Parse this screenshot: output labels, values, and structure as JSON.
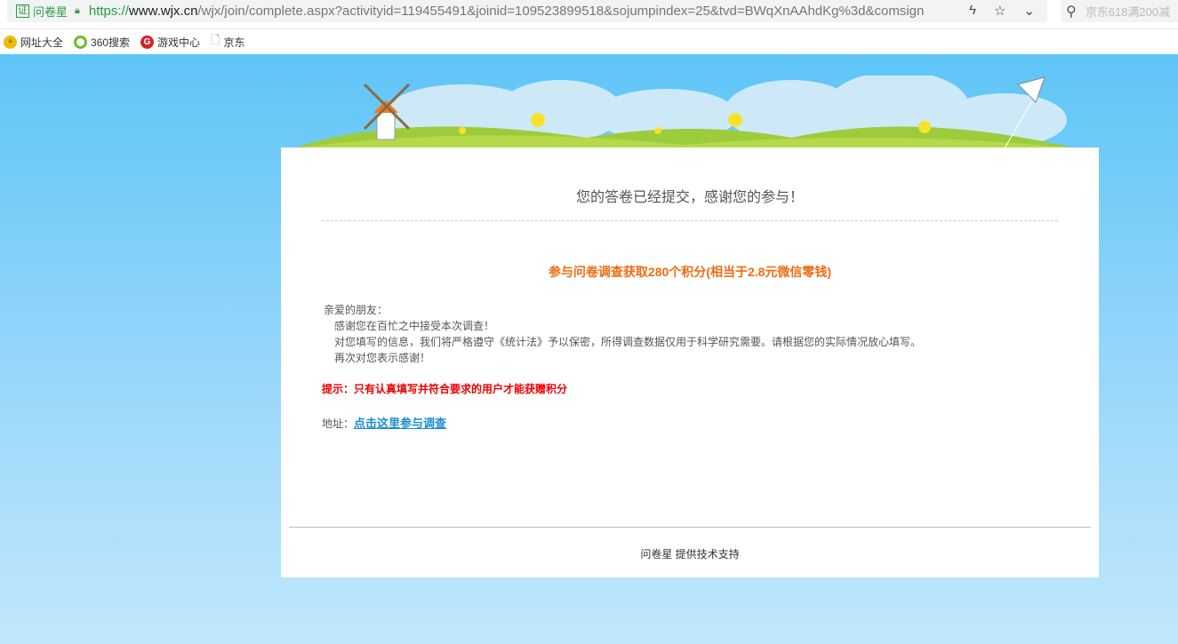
{
  "browser": {
    "site_name": "问卷星",
    "cert_label": "证",
    "url_scheme": "https://",
    "url_host": "www.wjx.cn",
    "url_path": "/wjx/join/complete.aspx?activityid=119455491&joinid=109523899518&sojumpindex=25&tvd=BWqXnAAhdKg%3d&comsign",
    "search_placeholder": "京东618满200减",
    "bookmarks": [
      {
        "label": "网址大全"
      },
      {
        "label": "360搜索"
      },
      {
        "label": "游戏中心"
      },
      {
        "label": "京东"
      }
    ]
  },
  "page": {
    "title": "您的答卷已经提交，感谢您的参与！",
    "reward": "参与问卷调查获取280个积分(相当于2.8元微信零钱)",
    "letter": [
      "亲爱的朋友：",
      "感谢您在百忙之中接受本次调查！",
      "对您填写的信息，我们将严格遵守《统计法》予以保密，所得调查数据仅用于科学研究需要。请根据您的实际情况放心填写。",
      "再次对您表示感谢！"
    ],
    "tip": "提示：只有认真填写并符合要求的用户才能获赠积分",
    "address_label": "地址：",
    "address_link": "点击这里参与调查",
    "footer": "问卷星 提供技术支持"
  }
}
